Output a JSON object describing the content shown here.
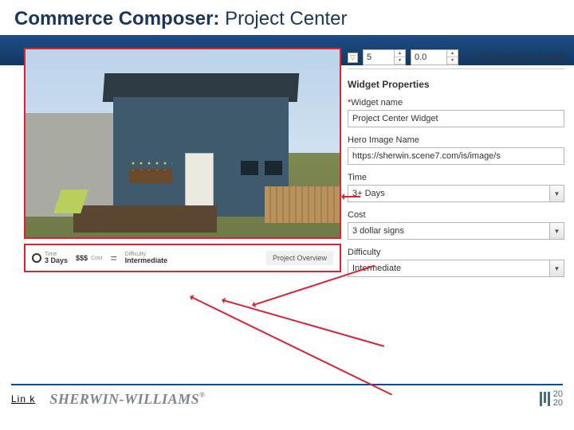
{
  "title": {
    "bold": "Commerce Composer:",
    "regular": " Project Center"
  },
  "preview": {
    "metrics": {
      "time_label": "Time",
      "time_value": "3 Days",
      "cost_label": "Cost",
      "cost_value": "$$$",
      "difficulty_label": "Difficulty",
      "difficulty_value": "Intermediate",
      "overview_label": "Project Overview"
    }
  },
  "panel": {
    "top": {
      "col": "5",
      "weight": "0.0",
      "name": "Project Center Widget"
    },
    "heading": "Widget Properties",
    "fields": {
      "widget_name": {
        "label": "Widget name",
        "value": "Project Center Widget"
      },
      "hero_image": {
        "label": "Hero Image Name",
        "value": "https://sherwin.scene7.com/is/image/s"
      },
      "time": {
        "label": "Time",
        "value": "3+ Days"
      },
      "cost": {
        "label": "Cost",
        "value": "3 dollar signs"
      },
      "difficulty": {
        "label": "Difficulty",
        "value": "Intermediate"
      }
    }
  },
  "footer": {
    "link": "Lin k",
    "brand": "SHERWIN-WILLIAMS",
    "logo": {
      "top": "20",
      "bottom": "20"
    }
  }
}
